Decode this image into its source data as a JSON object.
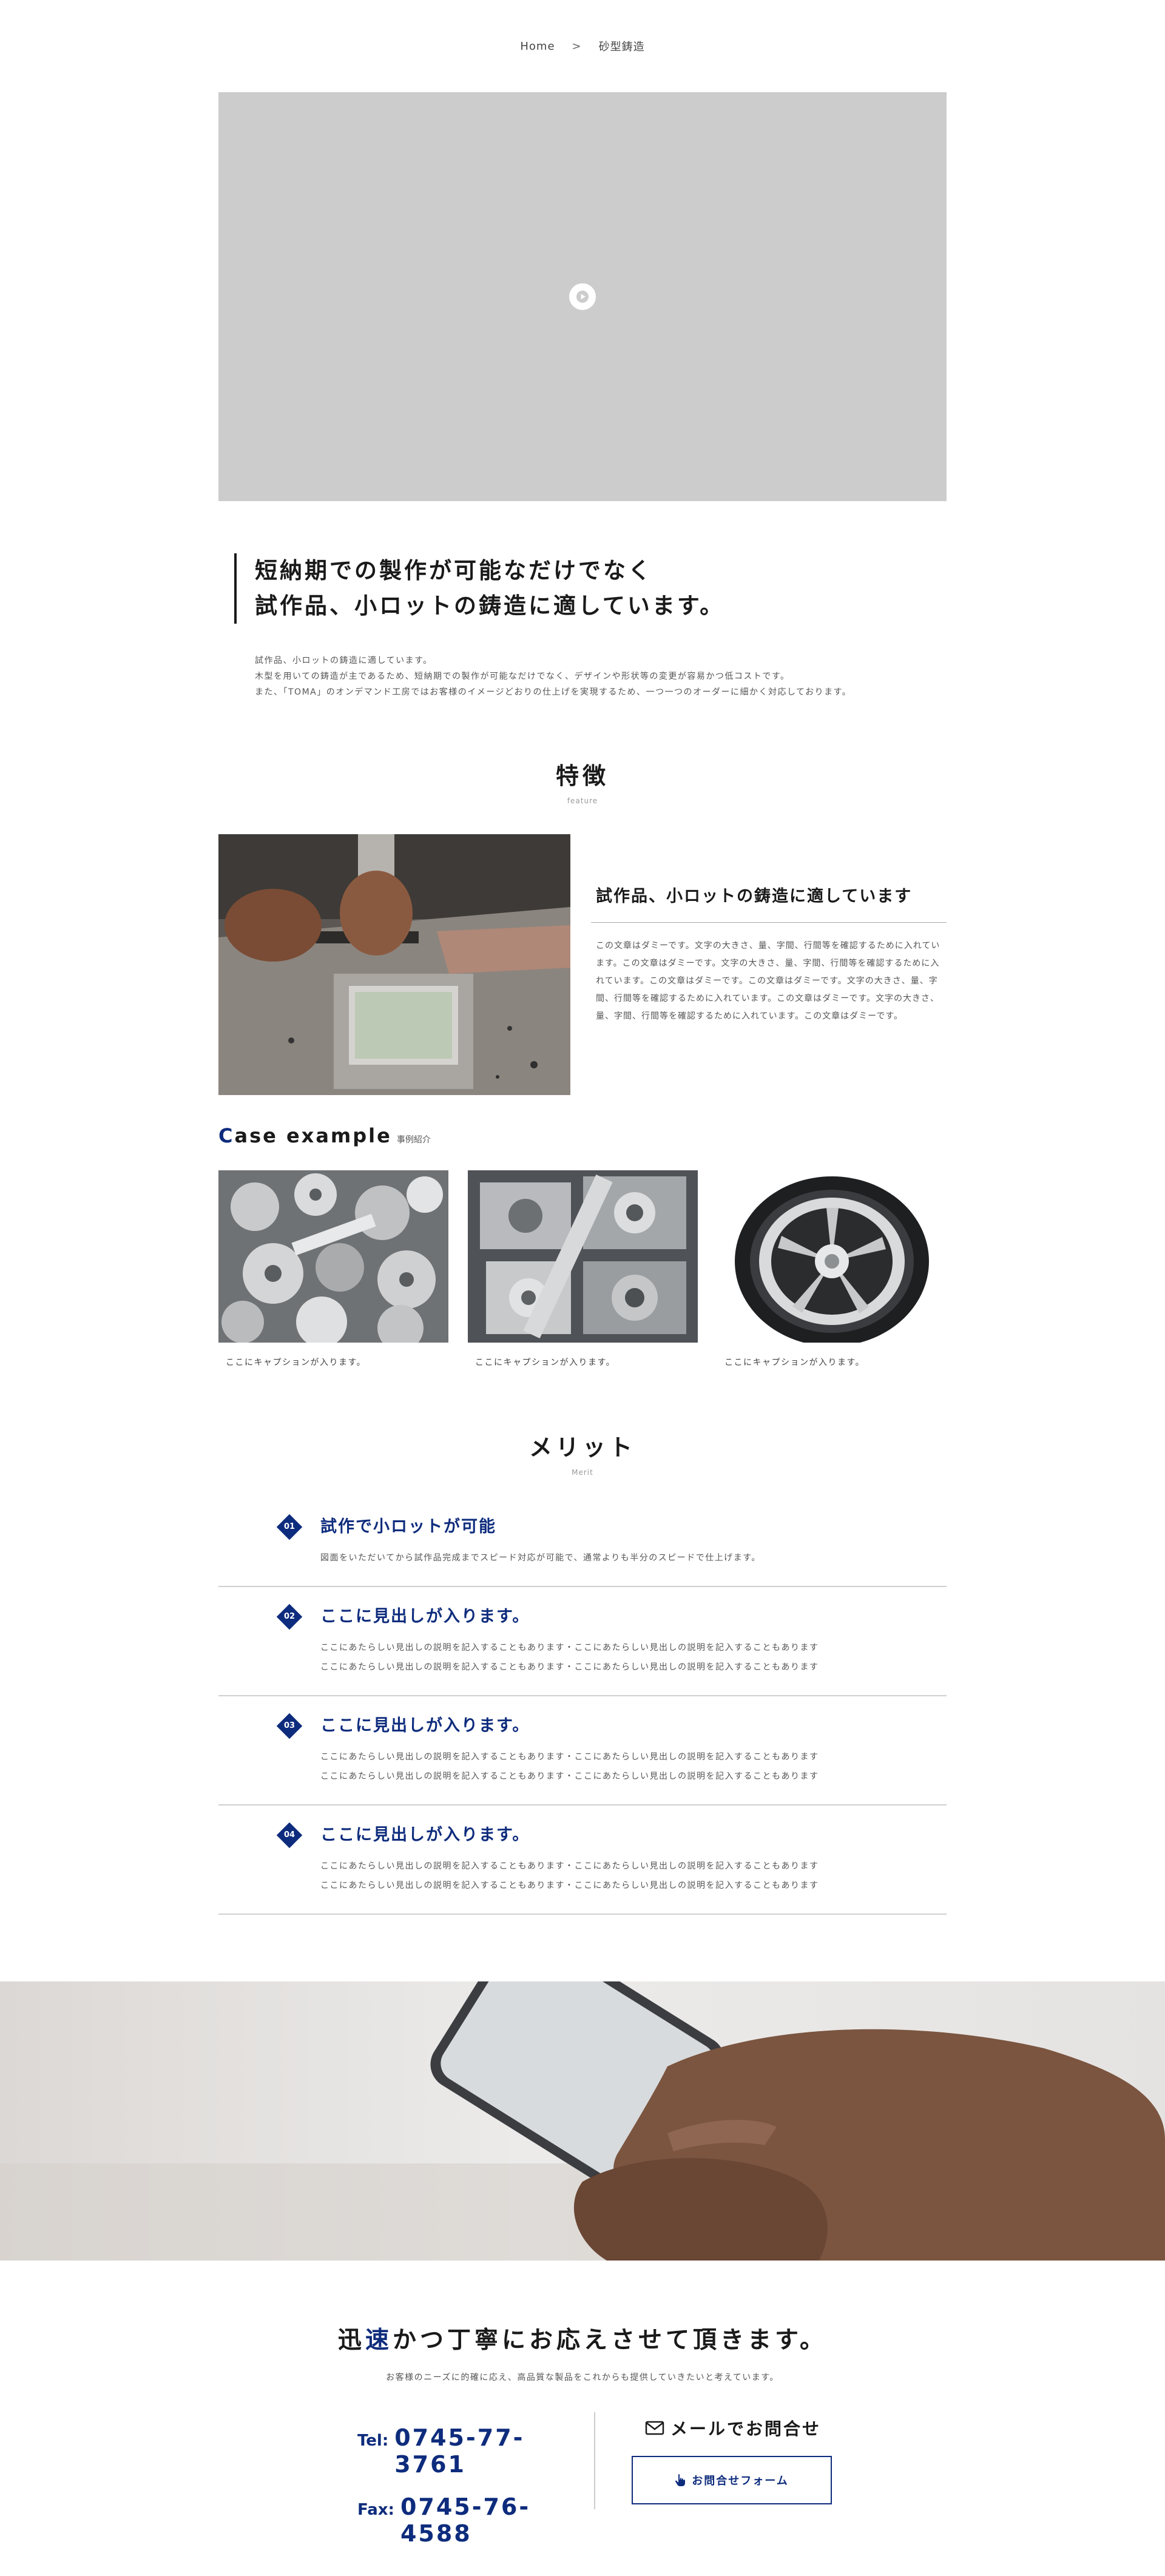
{
  "breadcrumb": {
    "home": "Home",
    "separator": ">",
    "current": "砂型鋳造"
  },
  "video": {
    "play_icon": "play-icon"
  },
  "intro": {
    "heading_line1": "短納期での製作が可能なだけでなく",
    "heading_line2": "試作品、小ロットの鋳造に適しています。",
    "text_line1": "試作品、小ロットの鋳造に適しています。",
    "text_line2": "木型を用いての鋳造が主であるため、短納期での製作が可能なだけでなく、デザインや形状等の変更が容易かつ低コストです。",
    "text_line3": "また、「TOMA」のオンデマンド工房ではお客様のイメージどおりの仕上げを実現するため、一つ一つのオーダーに細かく対応しております。"
  },
  "feature": {
    "title": "特徴",
    "subtitle": "feature",
    "heading": "試作品、小ロットの鋳造に適しています",
    "description": "この文章はダミーです。文字の大きさ、量、字間、行間等を確認するために入れています。この文章はダミーです。文字の大きさ、量、字間、行間等を確認するために入れています。この文章はダミーです。この文章はダミーです。文字の大きさ、量、字間、行間等を確認するために入れています。この文章はダミーです。文字の大きさ、量、字間、行間等を確認するために入れています。この文章はダミーです。"
  },
  "case": {
    "title_first": "C",
    "title_rest": "ase example",
    "title_ja": "事例紹介",
    "items": [
      {
        "caption": "ここにキャプションが入ります。"
      },
      {
        "caption": "ここにキャプションが入ります。"
      },
      {
        "caption": "ここにキャプションが入ります。"
      }
    ]
  },
  "merit": {
    "title": "メリット",
    "subtitle": "Merit",
    "items": [
      {
        "num": "01",
        "heading": "試作で小ロットが可能",
        "desc1": "図面をいただいてから試作品完成までスピード対応が可能で、通常よりも半分のスピードで仕上げます。",
        "desc2": ""
      },
      {
        "num": "02",
        "heading": "ここに見出しが入ります。",
        "desc1": "ここにあたらしい見出しの説明を記入することもあります・ここにあたらしい見出しの説明を記入することもあります",
        "desc2": "ここにあたらしい見出しの説明を記入することもあります・ここにあたらしい見出しの説明を記入することもあります"
      },
      {
        "num": "03",
        "heading": "ここに見出しが入ります。",
        "desc1": "ここにあたらしい見出しの説明を記入することもあります・ここにあたらしい見出しの説明を記入することもあります",
        "desc2": "ここにあたらしい見出しの説明を記入することもあります・ここにあたらしい見出しの説明を記入することもあります"
      },
      {
        "num": "04",
        "heading": "ここに見出しが入ります。",
        "desc1": "ここにあたらしい見出しの説明を記入することもあります・ここにあたらしい見出しの説明を記入することもあります",
        "desc2": "ここにあたらしい見出しの説明を記入することもあります・ここにあたらしい見出しの説明を記入することもあります"
      }
    ]
  },
  "contact": {
    "heading_a": "迅",
    "heading_b": "速",
    "heading_c": "かつ丁寧にお応えさせて頂きます。",
    "lead": "お客様のニーズに的確に応え、高品質な製品をこれからも提供していきたいと考えています。",
    "tel_label": "Tel:",
    "tel": "0745-77-3761",
    "fax_label": "Fax:",
    "fax": "0745-76-4588",
    "mail_label": "メールでお問合せ",
    "form_button": "お問合せフォーム"
  },
  "colors": {
    "accent": "#0e2c7d",
    "placeholder": "#cccccc"
  }
}
